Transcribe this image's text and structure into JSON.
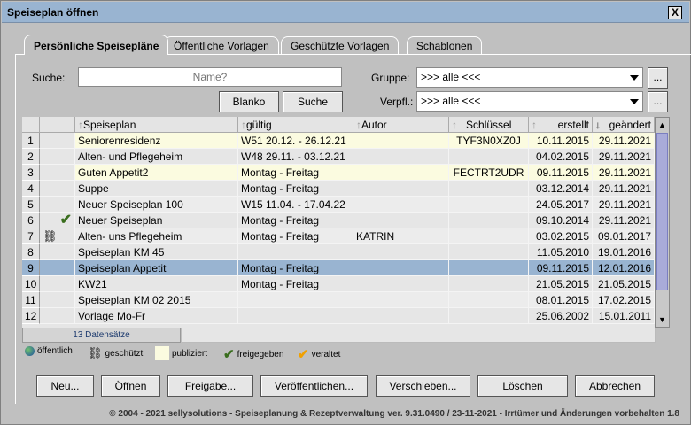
{
  "window": {
    "title": "Speiseplan öffnen",
    "close": "X"
  },
  "tabs": [
    "Persönliche Speisepläne",
    "Öffentliche Vorlagen",
    "Geschützte Vorlagen",
    "Schablonen"
  ],
  "search": {
    "label": "Suche:",
    "placeholder": "Name?",
    "blank_btn": "Blanko",
    "search_btn": "Suche"
  },
  "filters": {
    "group_label": "Gruppe:",
    "group_value": ">>> alle <<<",
    "verpfl_label": "Verpfl.:",
    "verpfl_value": ">>> alle <<<",
    "more": "..."
  },
  "table": {
    "columns": [
      "Speiseplan",
      "gültig",
      "Autor",
      "Schlüssel",
      "erstellt",
      "geändert"
    ],
    "rows": [
      {
        "n": "1",
        "icon": "",
        "name": "Seniorenresidenz",
        "valid": "W51 20.12. - 26.12.21",
        "author": "",
        "key": "TYF3N0XZ0J",
        "created": "10.11.2015",
        "changed": "29.11.2021",
        "pub": true
      },
      {
        "n": "2",
        "icon": "",
        "name": "Alten- und Pflegeheim",
        "valid": "W48 29.11. - 03.12.21",
        "author": "",
        "key": "",
        "created": "04.02.2015",
        "changed": "29.11.2021",
        "pub": false
      },
      {
        "n": "3",
        "icon": "",
        "name": "Guten Appetit2",
        "valid": "Montag - Freitag",
        "author": "",
        "key": "FECTRT2UDR",
        "created": "09.11.2015",
        "changed": "29.11.2021",
        "pub": true
      },
      {
        "n": "4",
        "icon": "",
        "name": "Suppe",
        "valid": "Montag - Freitag",
        "author": "",
        "key": "",
        "created": "03.12.2014",
        "changed": "29.11.2021",
        "pub": false
      },
      {
        "n": "5",
        "icon": "",
        "name": "Neuer Speiseplan 100",
        "valid": "W15 11.04. - 17.04.22",
        "author": "",
        "key": "",
        "created": "24.05.2017",
        "changed": "29.11.2021",
        "pub": false
      },
      {
        "n": "6",
        "icon": "check",
        "name": "Neuer Speiseplan",
        "valid": "Montag - Freitag",
        "author": "",
        "key": "",
        "created": "09.10.2014",
        "changed": "29.11.2021",
        "pub": false
      },
      {
        "n": "7",
        "icon": "chain",
        "name": "Alten- uns Pflegeheim",
        "valid": "Montag - Freitag",
        "author": "KATRIN",
        "key": "",
        "created": "03.02.2015",
        "changed": "09.01.2017",
        "pub": false
      },
      {
        "n": "8",
        "icon": "",
        "name": "Speiseplan KM 45",
        "valid": "",
        "author": "",
        "key": "",
        "created": "11.05.2010",
        "changed": "19.01.2016",
        "pub": false
      },
      {
        "n": "9",
        "icon": "",
        "name": "Speiseplan Appetit",
        "valid": "Montag - Freitag",
        "author": "",
        "key": "",
        "created": "09.11.2015",
        "changed": "12.01.2016",
        "pub": false,
        "selected": true
      },
      {
        "n": "10",
        "icon": "",
        "name": "KW21",
        "valid": "Montag - Freitag",
        "author": "",
        "key": "",
        "created": "21.05.2015",
        "changed": "21.05.2015",
        "pub": false
      },
      {
        "n": "11",
        "icon": "",
        "name": "Speiseplan KM 02 2015",
        "valid": "",
        "author": "",
        "key": "",
        "created": "08.01.2015",
        "changed": "17.02.2015",
        "pub": false
      },
      {
        "n": "12",
        "icon": "",
        "name": "Vorlage Mo-Fr",
        "valid": "",
        "author": "",
        "key": "",
        "created": "25.06.2002",
        "changed": "15.01.2011",
        "pub": false
      }
    ],
    "count": "13 Datensätze"
  },
  "legend": {
    "public": "öffentlich",
    "protected": "geschützt",
    "published": "publiziert",
    "released": "freigegeben",
    "outdated": "veraltet"
  },
  "buttons": [
    "Neu...",
    "Öffnen",
    "Freigabe...",
    "Veröffentlichen...",
    "Verschieben...",
    "Löschen",
    "Abbrechen"
  ],
  "footer": "© 2004 - 2021 sellysolutions - Speiseplanung & Rezeptverwaltung ver. 9.31.0490 / 23-11-2021 - Irrtümer und Änderungen vorbehalten  1.8",
  "colors": {
    "title": "#99b4d1",
    "published": "#fbfbe0",
    "selected": "#99b4d1",
    "check_green": "#3a6e1e",
    "check_orange": "#f0a000"
  }
}
